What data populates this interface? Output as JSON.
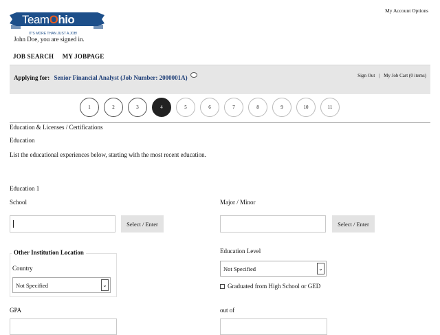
{
  "brand": {
    "logo_text_team": "Team",
    "logo_text_o": "O",
    "logo_text_hio": "hio",
    "tagline": "IT'S MORE THAN JUST A JOB!",
    "colors": {
      "banner": "#1d4f8a",
      "text": "#ffffff",
      "o_orange": "#e85b1e"
    }
  },
  "header": {
    "account_options": "My Account Options",
    "signed_in": "John Doe, you are signed in.",
    "nav": [
      "JOB SEARCH",
      "MY JOBPAGE"
    ]
  },
  "band": {
    "applying_label": "Applying for:",
    "job_title": "Senior Financial Analyst (Job Number: 2000001A)",
    "sign_out": "Sign Out",
    "separator": "|",
    "job_cart": "My Job Cart (0 items)"
  },
  "steps": {
    "items": [
      "1",
      "2",
      "3",
      "4",
      "5",
      "6",
      "7",
      "8",
      "9",
      "10",
      "11"
    ],
    "active": "4"
  },
  "form": {
    "section_title": "Education & Licenses / Certifications",
    "subsection": "Education",
    "instructions": "List the educational experiences below, starting with the most recent education.",
    "entry_title": "Education 1",
    "school_label": "School",
    "major_label": "Major / Minor",
    "select_enter": "Select / Enter",
    "other_location_legend": "Other Institution Location",
    "country_label": "Country",
    "country_value": "Not Specified",
    "education_level_label": "Education Level",
    "education_level_value": "Not Specified",
    "graduated_label": "Graduated from High School or GED",
    "gpa_label": "GPA",
    "out_of_label": "out of"
  }
}
